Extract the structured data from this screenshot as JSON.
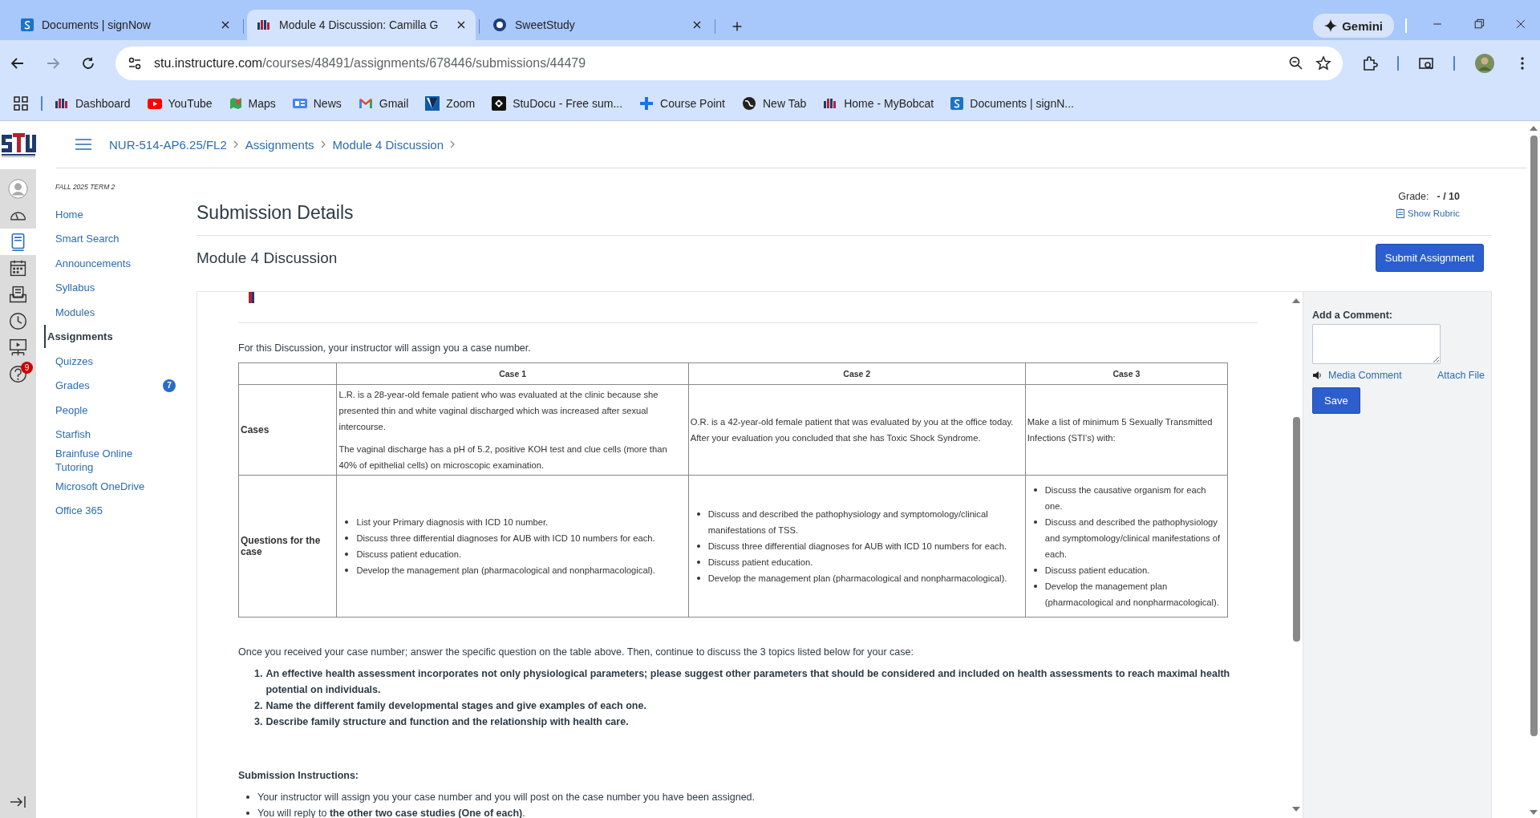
{
  "browser": {
    "tabs": [
      {
        "title": "Documents | signNow",
        "selected": false
      },
      {
        "title": "Module 4 Discussion: Camilla G",
        "selected": true
      },
      {
        "title": "SweetStudy",
        "selected": false
      }
    ],
    "gemini": "Gemini",
    "url_host": "stu.instructure.com",
    "url_path": "/courses/48491/assignments/678446/submissions/44479",
    "bookmarks": [
      "Dashboard",
      "YouTube",
      "Maps",
      "News",
      "Gmail",
      "Zoom",
      "StuDocu - Free sum...",
      "Course Point",
      "New Tab",
      "Home - MyBobcat",
      "Documents | signN..."
    ]
  },
  "global_nav": {
    "items": [
      {
        "selected": false
      },
      {
        "selected": false
      },
      {
        "selected": true
      },
      {
        "selected": false
      },
      {
        "selected": false
      },
      {
        "selected": false
      },
      {
        "selected": false
      },
      {
        "selected": false,
        "badge": "9"
      }
    ]
  },
  "breadcrumbs": [
    "NUR-514-AP6.25/FL2",
    "Assignments",
    "Module 4 Discussion"
  ],
  "course_nav": {
    "term": "FALL 2025 TERM 2",
    "items": [
      {
        "label": "Home",
        "selected": false
      },
      {
        "label": "Smart Search",
        "selected": false
      },
      {
        "label": "Announcements",
        "selected": false
      },
      {
        "label": "Syllabus",
        "selected": false
      },
      {
        "label": "Modules",
        "selected": false
      },
      {
        "label": "Assignments",
        "selected": true
      },
      {
        "label": "Quizzes",
        "selected": false
      },
      {
        "label": "Grades",
        "selected": false,
        "badge": "7"
      },
      {
        "label": "People",
        "selected": false
      },
      {
        "label": "Starfish",
        "selected": false
      },
      {
        "label": "Brainfuse Online Tutoring",
        "selected": false
      },
      {
        "label": "Microsoft OneDrive",
        "selected": false
      },
      {
        "label": "Office 365",
        "selected": false
      }
    ]
  },
  "submission": {
    "title": "Submission Details",
    "grade_label": "Grade:",
    "grade_value": "- / 10",
    "rubric_link": "Show Rubric",
    "assignment": "Module 4 Discussion",
    "submit_button": "Submit Assignment"
  },
  "content": {
    "intro": "For this Discussion, your instructor will assign you a case number.",
    "table": {
      "columns": [
        "Case 1",
        "Case 2",
        "Case 3"
      ],
      "rows": [
        {
          "header": "Cases",
          "cells": [
            {
              "paragraphs": [
                "L.R. is a 28-year-old female patient who was evaluated at the clinic because she presented thin and white vaginal discharged which was increased after sexual intercourse.",
                "The vaginal discharge has a pH of 5.2, positive KOH test and clue cells (more than 40% of epithelial cells) on microscopic examination."
              ]
            },
            {
              "paragraphs": [
                "O.R. is a 42-year-old female patient that was evaluated by you at the office today. After your evaluation you concluded that she has Toxic Shock Syndrome."
              ]
            },
            {
              "paragraphs": [
                "Make a list of minimum 5 Sexually Transmitted Infections (STI’s) with:"
              ]
            }
          ]
        },
        {
          "header": "Questions for the case",
          "cells": [
            {
              "bullets": [
                "List your Primary diagnosis with ICD 10 number.",
                "Discuss three differential diagnoses for AUB with ICD 10 numbers for each.",
                "Discuss patient education.",
                "Develop the management plan (pharmacological and nonpharmacological)."
              ]
            },
            {
              "bullets": [
                "Discuss and described the pathophysiology and symptomology/clinical manifestations of TSS.",
                "Discuss three differential diagnoses for AUB with ICD 10 numbers for each.",
                "Discuss patient education.",
                "Develop the management plan (pharmacological and nonpharmacological)."
              ]
            },
            {
              "bullets": [
                "Discuss the causative organism for each one.",
                "Discuss and described the pathophysiology and symptomology/clinical manifestations of each.",
                "Discuss patient education.",
                "Develop the management plan (pharmacological and nonpharmacological)."
              ]
            }
          ]
        }
      ]
    },
    "followup": "Once you received your case number; answer the specific question on the table above. Then, continue to discuss the 3 topics listed below for your case:",
    "topics": [
      {
        "number": "1.",
        "text": "An effective health assessment incorporates not only physiological parameters; please suggest other parameters that should be considered and included on health assessments to reach maximal health potential on individuals."
      },
      {
        "number": "2.",
        "text": "Name the different family developmental stages and give examples of each one."
      },
      {
        "number": "3.",
        "text": "Describe family structure and function and the relationship with health care."
      }
    ],
    "submission_heading": "Submission Instructions:",
    "instructions": [
      "Your instructor will assign you your case number and you will post on the case number you have been assigned.",
      "You will reply to **the other two case studies (One of each)**."
    ]
  },
  "comments": {
    "label": "Add a Comment:",
    "media": "Media Comment",
    "attach": "Attach File",
    "save": "Save"
  }
}
